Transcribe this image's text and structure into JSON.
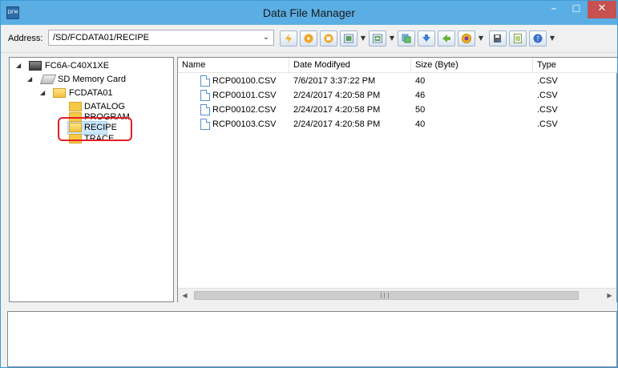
{
  "window": {
    "title": "Data File Manager",
    "app_icon_text": "DFM",
    "minimize_glyph": "–",
    "maximize_glyph": "☐",
    "close_glyph": "✕"
  },
  "address": {
    "label": "Address:",
    "value": "/SD/FCDATA01/RECIPE"
  },
  "toolbar": {
    "buttons": [
      {
        "icon": "lightning-icon",
        "color": "#f0b020"
      },
      {
        "icon": "play-icon",
        "color": "#f3a323"
      },
      {
        "icon": "stop-icon",
        "color": "#f3a323"
      },
      {
        "icon": "upload-icon",
        "color": "#5aa05a"
      },
      {
        "icon": "download-icon",
        "color": "#5aa05a"
      },
      {
        "icon": "copy-icon",
        "color": "#4a8fd0"
      },
      {
        "icon": "arrow-down-icon",
        "color": "#3a7fd0"
      },
      {
        "icon": "refresh-icon",
        "color": "#6cb040"
      },
      {
        "icon": "globe-icon",
        "color": "#f0b020"
      },
      {
        "icon": "save-icon",
        "color": "#555555"
      },
      {
        "icon": "document-icon",
        "color": "#7aa048"
      },
      {
        "icon": "help-icon",
        "color": "#3a6fc8"
      }
    ]
  },
  "tree": {
    "expand_glyph": "◢",
    "device": "FC6A-C40X1XE",
    "sd_card": "SD Memory Card",
    "root_folder": "FCDATA01",
    "folders": [
      "DATALOG",
      "PROGRAM",
      "RECIPE",
      "TRACE"
    ],
    "selected": "RECIPE"
  },
  "list": {
    "columns": [
      "Name",
      "Date Modifyed",
      "Size (Byte)",
      "Type"
    ],
    "rows": [
      {
        "name": "RCP00100.CSV",
        "date": "7/6/2017 3:37:22 PM",
        "size": "40",
        "type": ".CSV"
      },
      {
        "name": "RCP00101.CSV",
        "date": "2/24/2017 4:20:58 PM",
        "size": "46",
        "type": ".CSV"
      },
      {
        "name": "RCP00102.CSV",
        "date": "2/24/2017 4:20:58 PM",
        "size": "50",
        "type": ".CSV"
      },
      {
        "name": "RCP00103.CSV",
        "date": "2/24/2017 4:20:58 PM",
        "size": "40",
        "type": ".CSV"
      }
    ]
  },
  "scroll": {
    "left_glyph": "◀",
    "right_glyph": "▶"
  },
  "colors": {
    "titlebar": "#5aaee4",
    "close_button": "#c75050",
    "highlight": "#e21f26",
    "selection": "#cce8ff"
  }
}
